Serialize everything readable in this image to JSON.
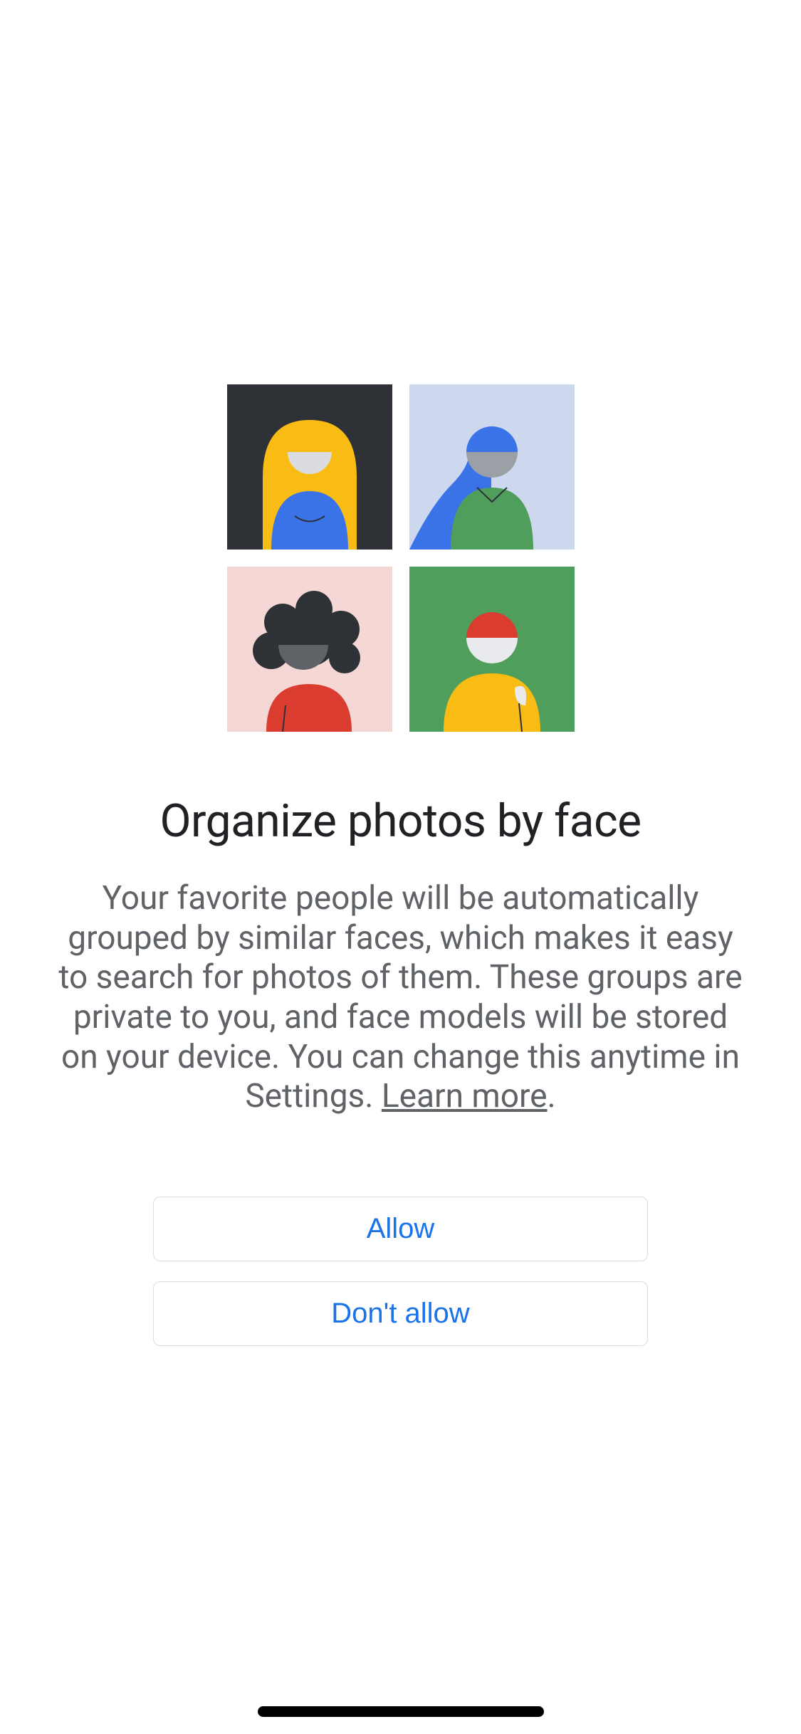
{
  "title": "Organize photos by face",
  "description": "Your favorite people will be automatically grouped by similar faces, which makes it easy to search for photos of them. These groups are private to you, and face models will be stored on your device. You can change this anytime in Settings. ",
  "learn_more": "Learn more",
  "period": ".",
  "buttons": {
    "allow": "Allow",
    "dont_allow": "Don't allow"
  }
}
